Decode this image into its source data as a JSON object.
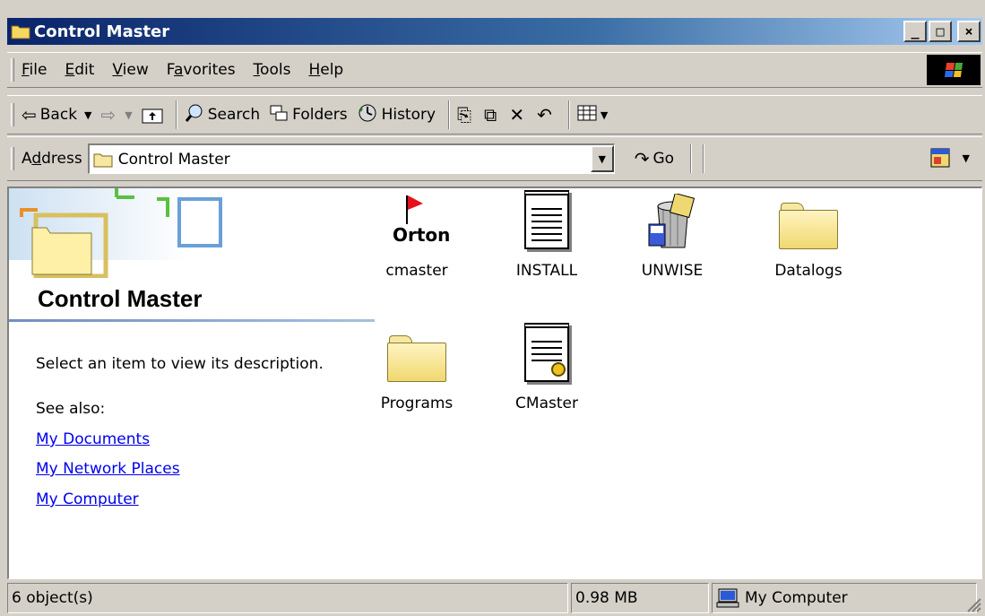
{
  "window": {
    "title": "Control Master",
    "controls": {
      "minimize": "_",
      "maximize": "□",
      "close": "×"
    }
  },
  "menu": {
    "items": [
      {
        "underline": "F",
        "rest": "ile"
      },
      {
        "underline": "E",
        "rest": "dit"
      },
      {
        "underline": "V",
        "rest": "iew"
      },
      {
        "prefix": "F",
        "underline": "a",
        "rest": "vorites"
      },
      {
        "underline": "T",
        "rest": "ools"
      },
      {
        "underline": "H",
        "rest": "elp"
      }
    ]
  },
  "toolbar": {
    "back_label": "Back",
    "search_label": "Search",
    "folders_label": "Folders",
    "history_label": "History"
  },
  "address": {
    "label_prefix": "A",
    "label_underline": "d",
    "label_rest": "dress",
    "value": "Control Master",
    "go_label": "Go"
  },
  "panel": {
    "title": "Control Master",
    "description": "Select an item to view its description.",
    "see_also": "See also:",
    "links": [
      "My Documents",
      "My Network Places",
      "My Computer"
    ]
  },
  "files": [
    {
      "name": "cmaster",
      "icon": "orton-flag-icon",
      "logo_text": "Orton"
    },
    {
      "name": "INSTALL",
      "icon": "text-document-icon"
    },
    {
      "name": "UNWISE",
      "icon": "uninstall-icon"
    },
    {
      "name": "Datalogs",
      "icon": "folder-icon"
    },
    {
      "name": "Programs",
      "icon": "folder-icon"
    },
    {
      "name": "CMaster",
      "icon": "config-document-icon"
    }
  ],
  "status": {
    "objects": "6 object(s)",
    "size": "0.98 MB",
    "zone": "My Computer"
  }
}
